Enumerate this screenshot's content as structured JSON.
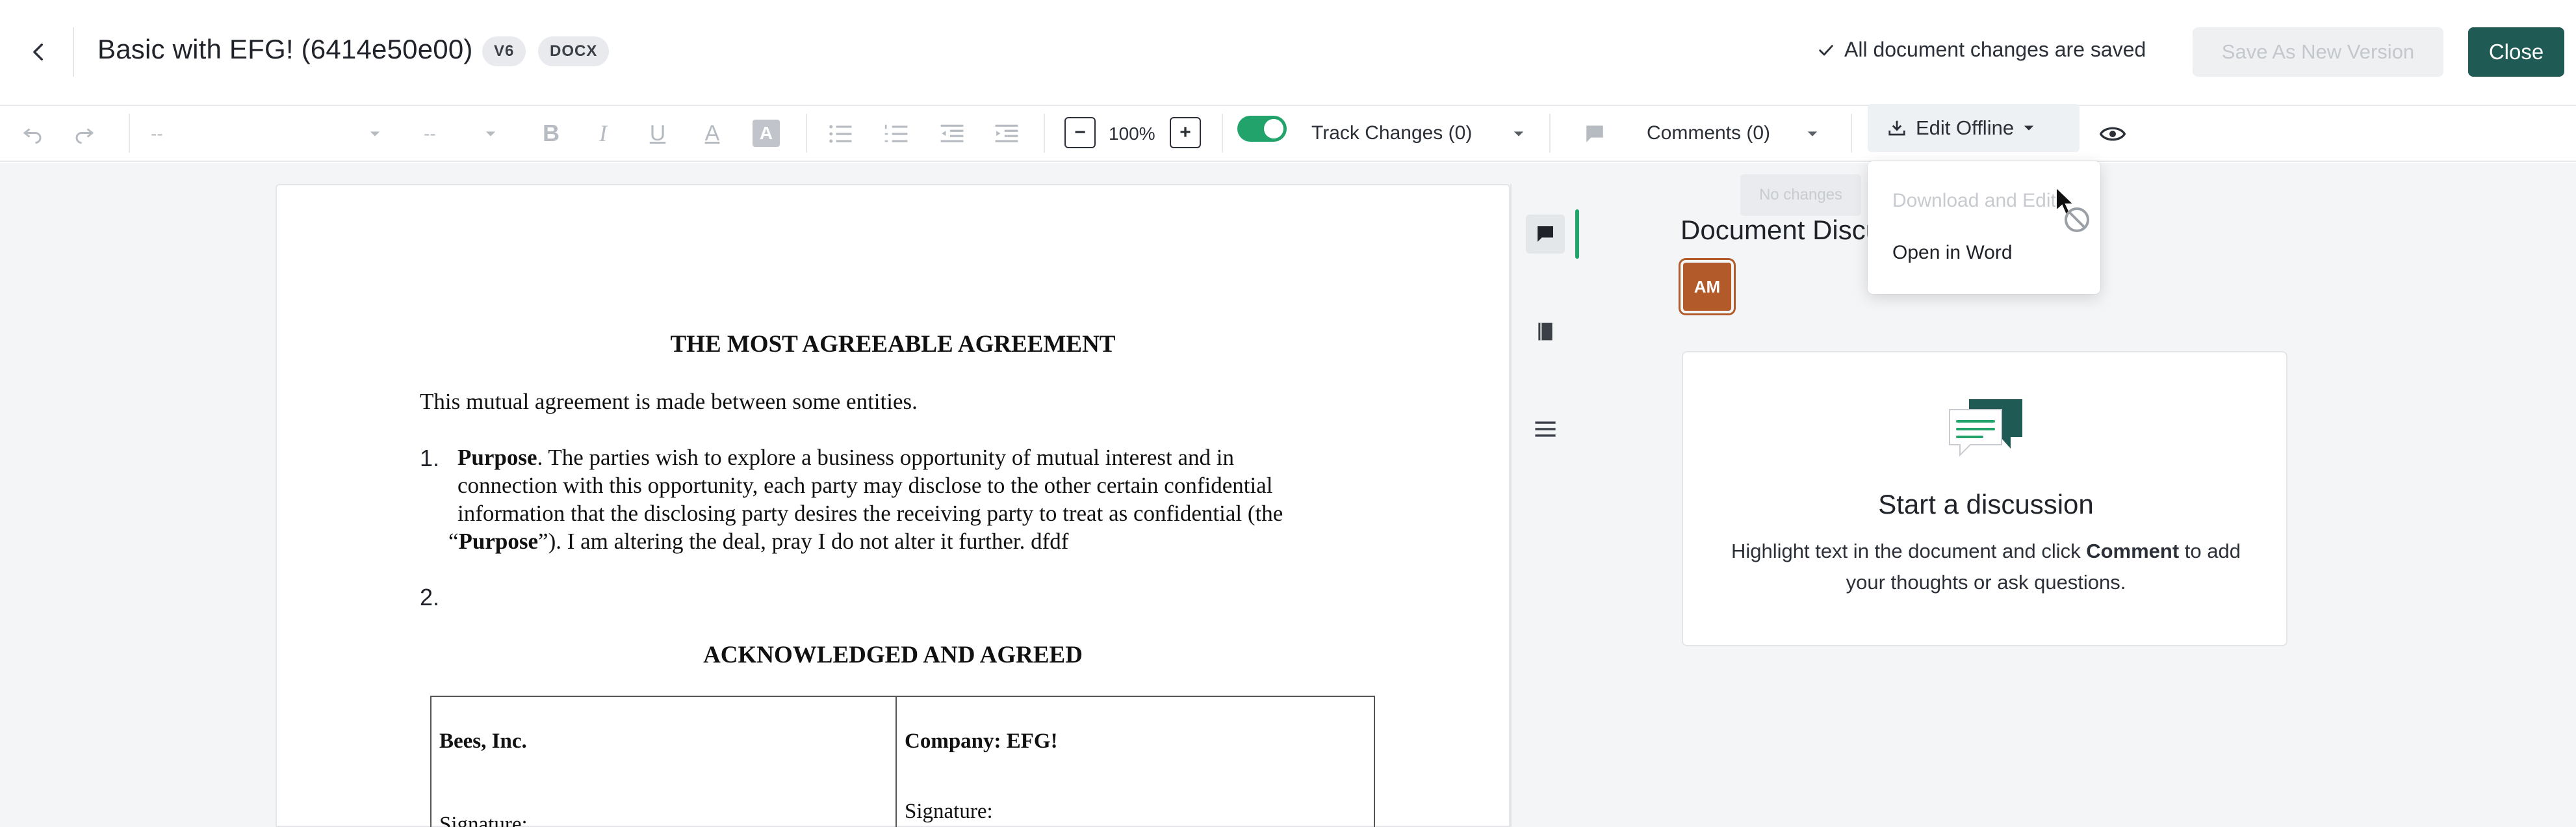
{
  "header": {
    "title": "Basic with EFG! (6414e50e00)",
    "version_badge": "V6",
    "format_badge": "DOCX",
    "save_status": "All document changes are saved",
    "save_version_label": "Save As New Version",
    "close_label": "Close"
  },
  "toolbar": {
    "font_family_value": "--",
    "font_size_value": "--",
    "zoom_minus": "−",
    "zoom_level": "100%",
    "zoom_plus": "+",
    "track_changes_label": "Track Changes (0)",
    "comments_label": "Comments (0)",
    "edit_offline_label": "Edit Offline",
    "formatting": {
      "bold": "B",
      "italic": "I",
      "underline": "U",
      "font_color": "A",
      "highlight": "A"
    }
  },
  "edit_offline_menu": {
    "ghost_tooltip": "No changes",
    "items": [
      {
        "label": "Download and Edit",
        "enabled": false
      },
      {
        "label": "Open in Word",
        "enabled": true
      }
    ]
  },
  "document": {
    "heading": "THE MOST AGREEABLE AGREEMENT",
    "intro": "This mutual agreement is made between some entities.",
    "clause1_number": "1.",
    "clause1_term": "Purpose",
    "clause1_line1_rest": ".  The parties wish to explore a business opportunity of mutual interest and in",
    "clause1_line2": "connection with this opportunity, each party may disclose to the other certain confidential",
    "clause1_line3": "information that the disclosing party desires the receiving party to treat as confidential (the",
    "clause1_line4_open": "“",
    "clause1_line4_term": "Purpose",
    "clause1_line4_rest": "”). I am altering the deal, pray I do not alter it further. dfdf",
    "clause2_number": "2.",
    "ack_heading": "ACKNOWLEDGED AND AGREED",
    "party_left": "Bees, Inc.",
    "party_right": "Company: EFG!",
    "signature_left": "Signature:",
    "signature_right": "Signature:"
  },
  "discussion": {
    "panel_title": "Document Discussion",
    "avatar_initials": "AM",
    "empty_title": "Start a discussion",
    "empty_body_before": "Highlight text in the document and click ",
    "empty_body_strong": "Comment",
    "empty_body_after": " to add your thoughts or ask questions."
  },
  "colors": {
    "accent_green": "#22a36b",
    "close_button": "#1f5a54",
    "avatar": "#b35a2a"
  }
}
